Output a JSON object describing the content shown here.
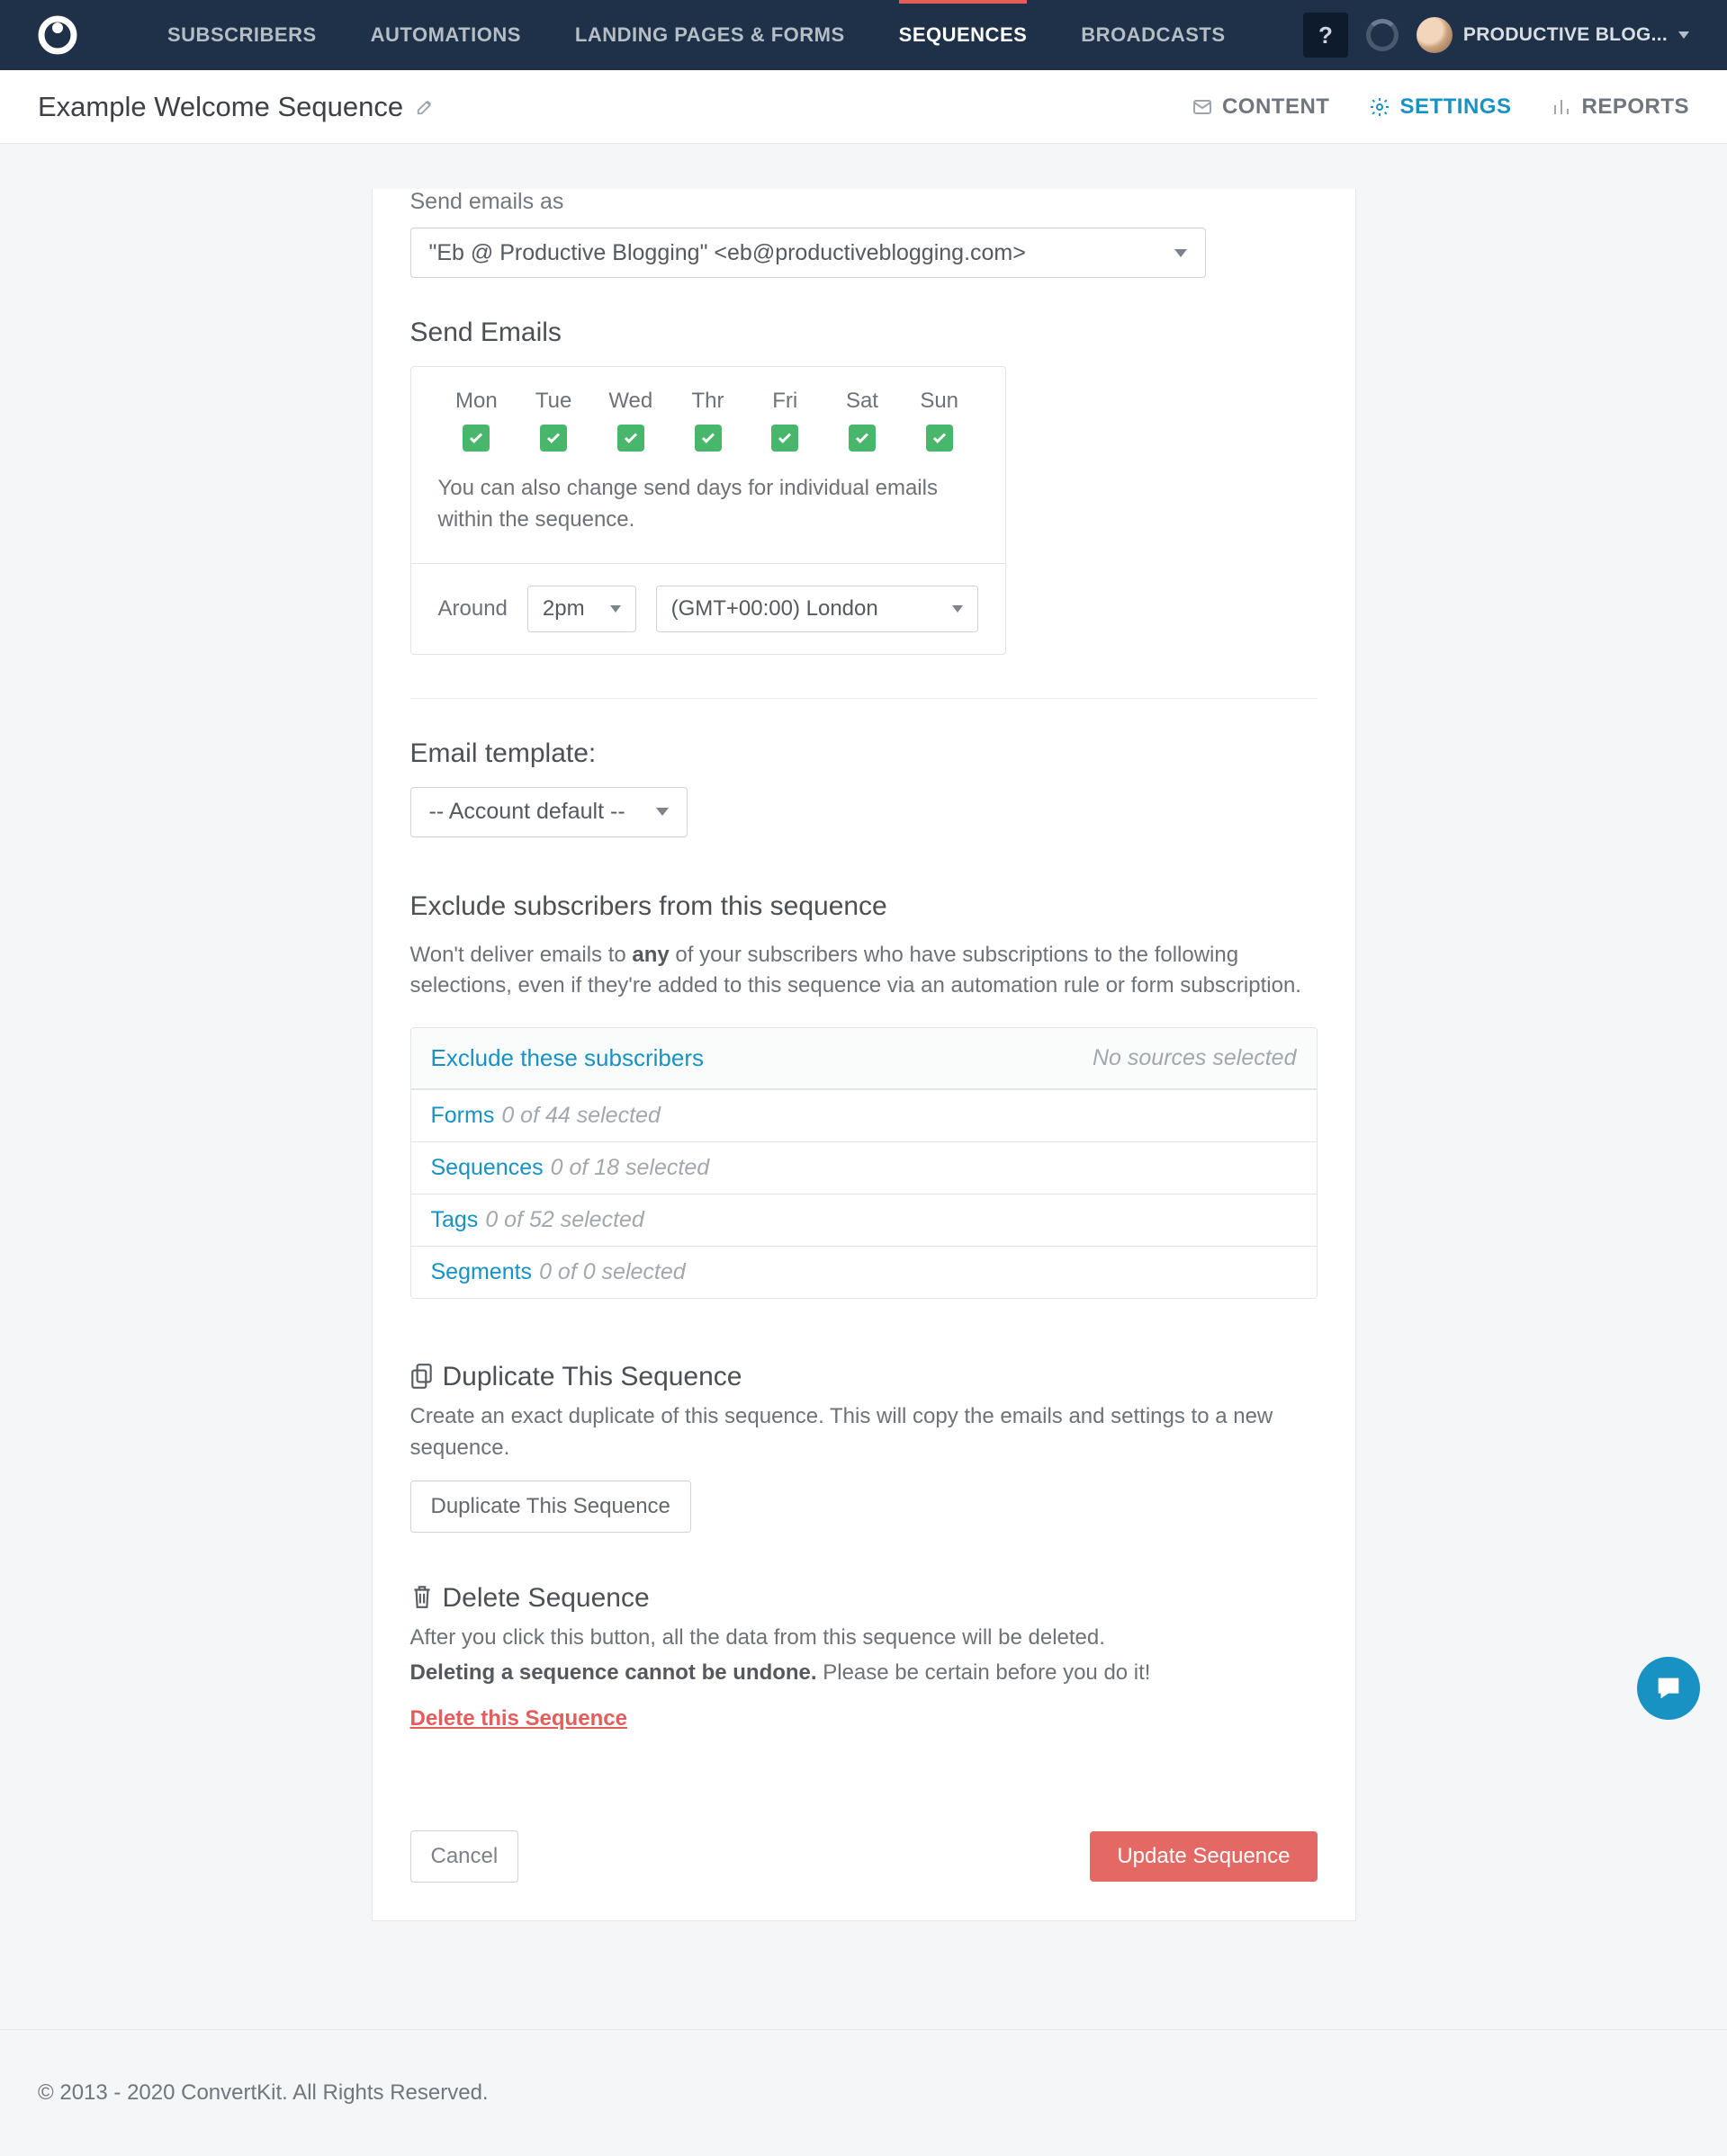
{
  "nav": {
    "items": [
      "SUBSCRIBERS",
      "AUTOMATIONS",
      "LANDING PAGES & FORMS",
      "SEQUENCES",
      "BROADCASTS"
    ],
    "active_index": 3,
    "help": "?",
    "user": "PRODUCTIVE BLOG..."
  },
  "subheader": {
    "title": "Example Welcome Sequence",
    "tabs": {
      "content": "CONTENT",
      "settings": "SETTINGS",
      "reports": "REPORTS"
    }
  },
  "send_as": {
    "label": "Send emails as",
    "value": "\"Eb @ Productive Blogging\" <eb@productiveblogging.com>"
  },
  "send_emails": {
    "heading": "Send Emails",
    "days": [
      "Mon",
      "Tue",
      "Wed",
      "Thr",
      "Fri",
      "Sat",
      "Sun"
    ],
    "note": "You can also change send days for individual emails within the sequence.",
    "around_label": "Around",
    "time": "2pm",
    "timezone": "(GMT+00:00) London"
  },
  "template": {
    "heading": "Email template:",
    "value": "-- Account default --"
  },
  "exclude": {
    "heading": "Exclude subscribers from this sequence",
    "desc_a": "Won't deliver emails to ",
    "desc_bold": "any",
    "desc_b": " of your subscribers who have subscriptions to the following selections, even if they're added to this sequence via an automation rule or form subscription.",
    "panel_title": "Exclude these subscribers",
    "panel_right": "No sources selected",
    "rows": [
      {
        "name": "Forms",
        "count": "0 of 44 selected"
      },
      {
        "name": "Sequences",
        "count": "0 of 18 selected"
      },
      {
        "name": "Tags",
        "count": "0 of 52 selected"
      },
      {
        "name": "Segments",
        "count": "0 of 0 selected"
      }
    ]
  },
  "duplicate": {
    "heading": "Duplicate This Sequence",
    "desc": "Create an exact duplicate of this sequence. This will copy the emails and settings to a new sequence.",
    "button": "Duplicate This Sequence"
  },
  "delete": {
    "heading": "Delete Sequence",
    "desc1": "After you click this button, all the data from this sequence will be deleted.",
    "desc2_bold": "Deleting a sequence cannot be undone.",
    "desc2_rest": " Please be certain before you do it!",
    "link": "Delete this Sequence"
  },
  "actions": {
    "cancel": "Cancel",
    "update": "Update Sequence"
  },
  "footer": {
    "copyright": "© 2013 - 2020 ConvertKit. All Rights Reserved."
  }
}
